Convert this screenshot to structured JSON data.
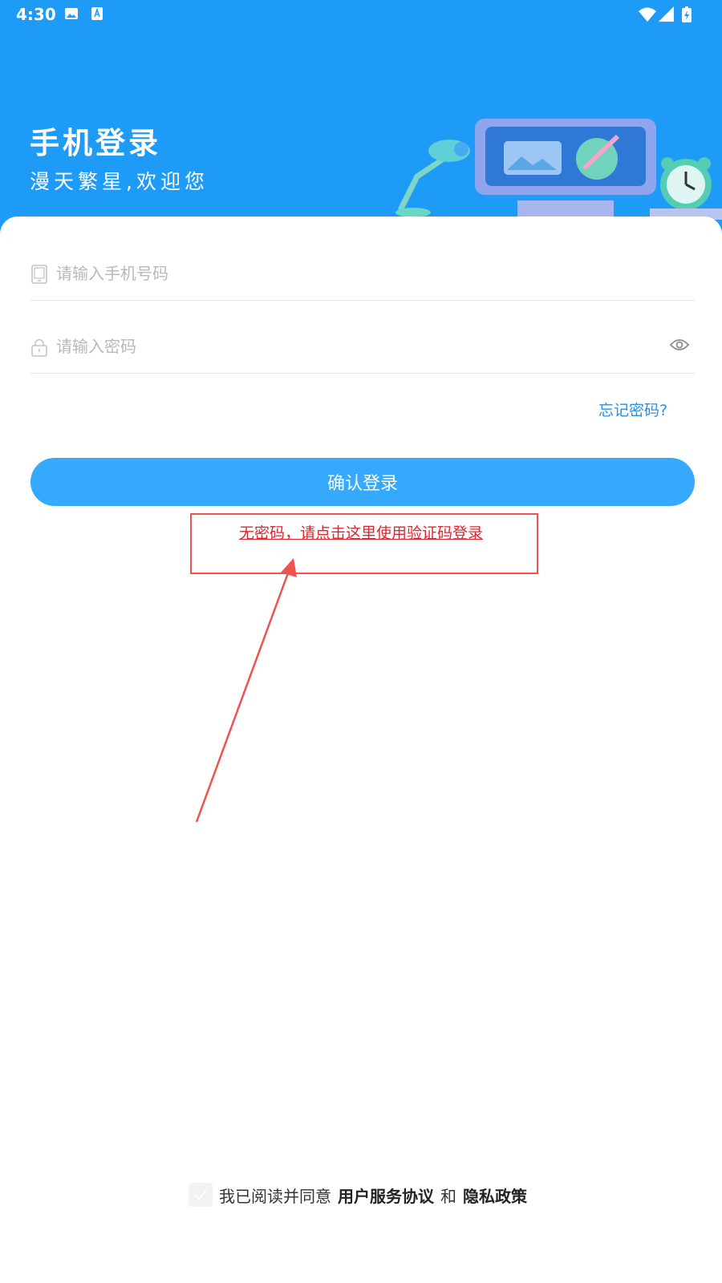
{
  "status_bar": {
    "time": "4:30"
  },
  "header": {
    "title": "手机登录",
    "subtitle": "漫天繁星,欢迎您"
  },
  "form": {
    "phone_placeholder": "请输入手机号码",
    "password_placeholder": "请输入密码",
    "forgot_label": "忘记密码?",
    "login_label": "确认登录",
    "code_login_label": "无密码，请点击这里使用验证码登录"
  },
  "agreement": {
    "prefix": "我已阅读并同意",
    "terms_label": "用户服务协议",
    "and_label": "和",
    "privacy_label": "隐私政策"
  },
  "colors": {
    "header_bg": "#1d9bf6",
    "button_bg": "#35a9fb",
    "link_blue": "#2c8fde",
    "annotation_red": "#e0242d"
  },
  "icons": {
    "phone": "phone-icon",
    "lock": "lock-icon",
    "eye": "eye-icon",
    "check": "check-icon"
  }
}
